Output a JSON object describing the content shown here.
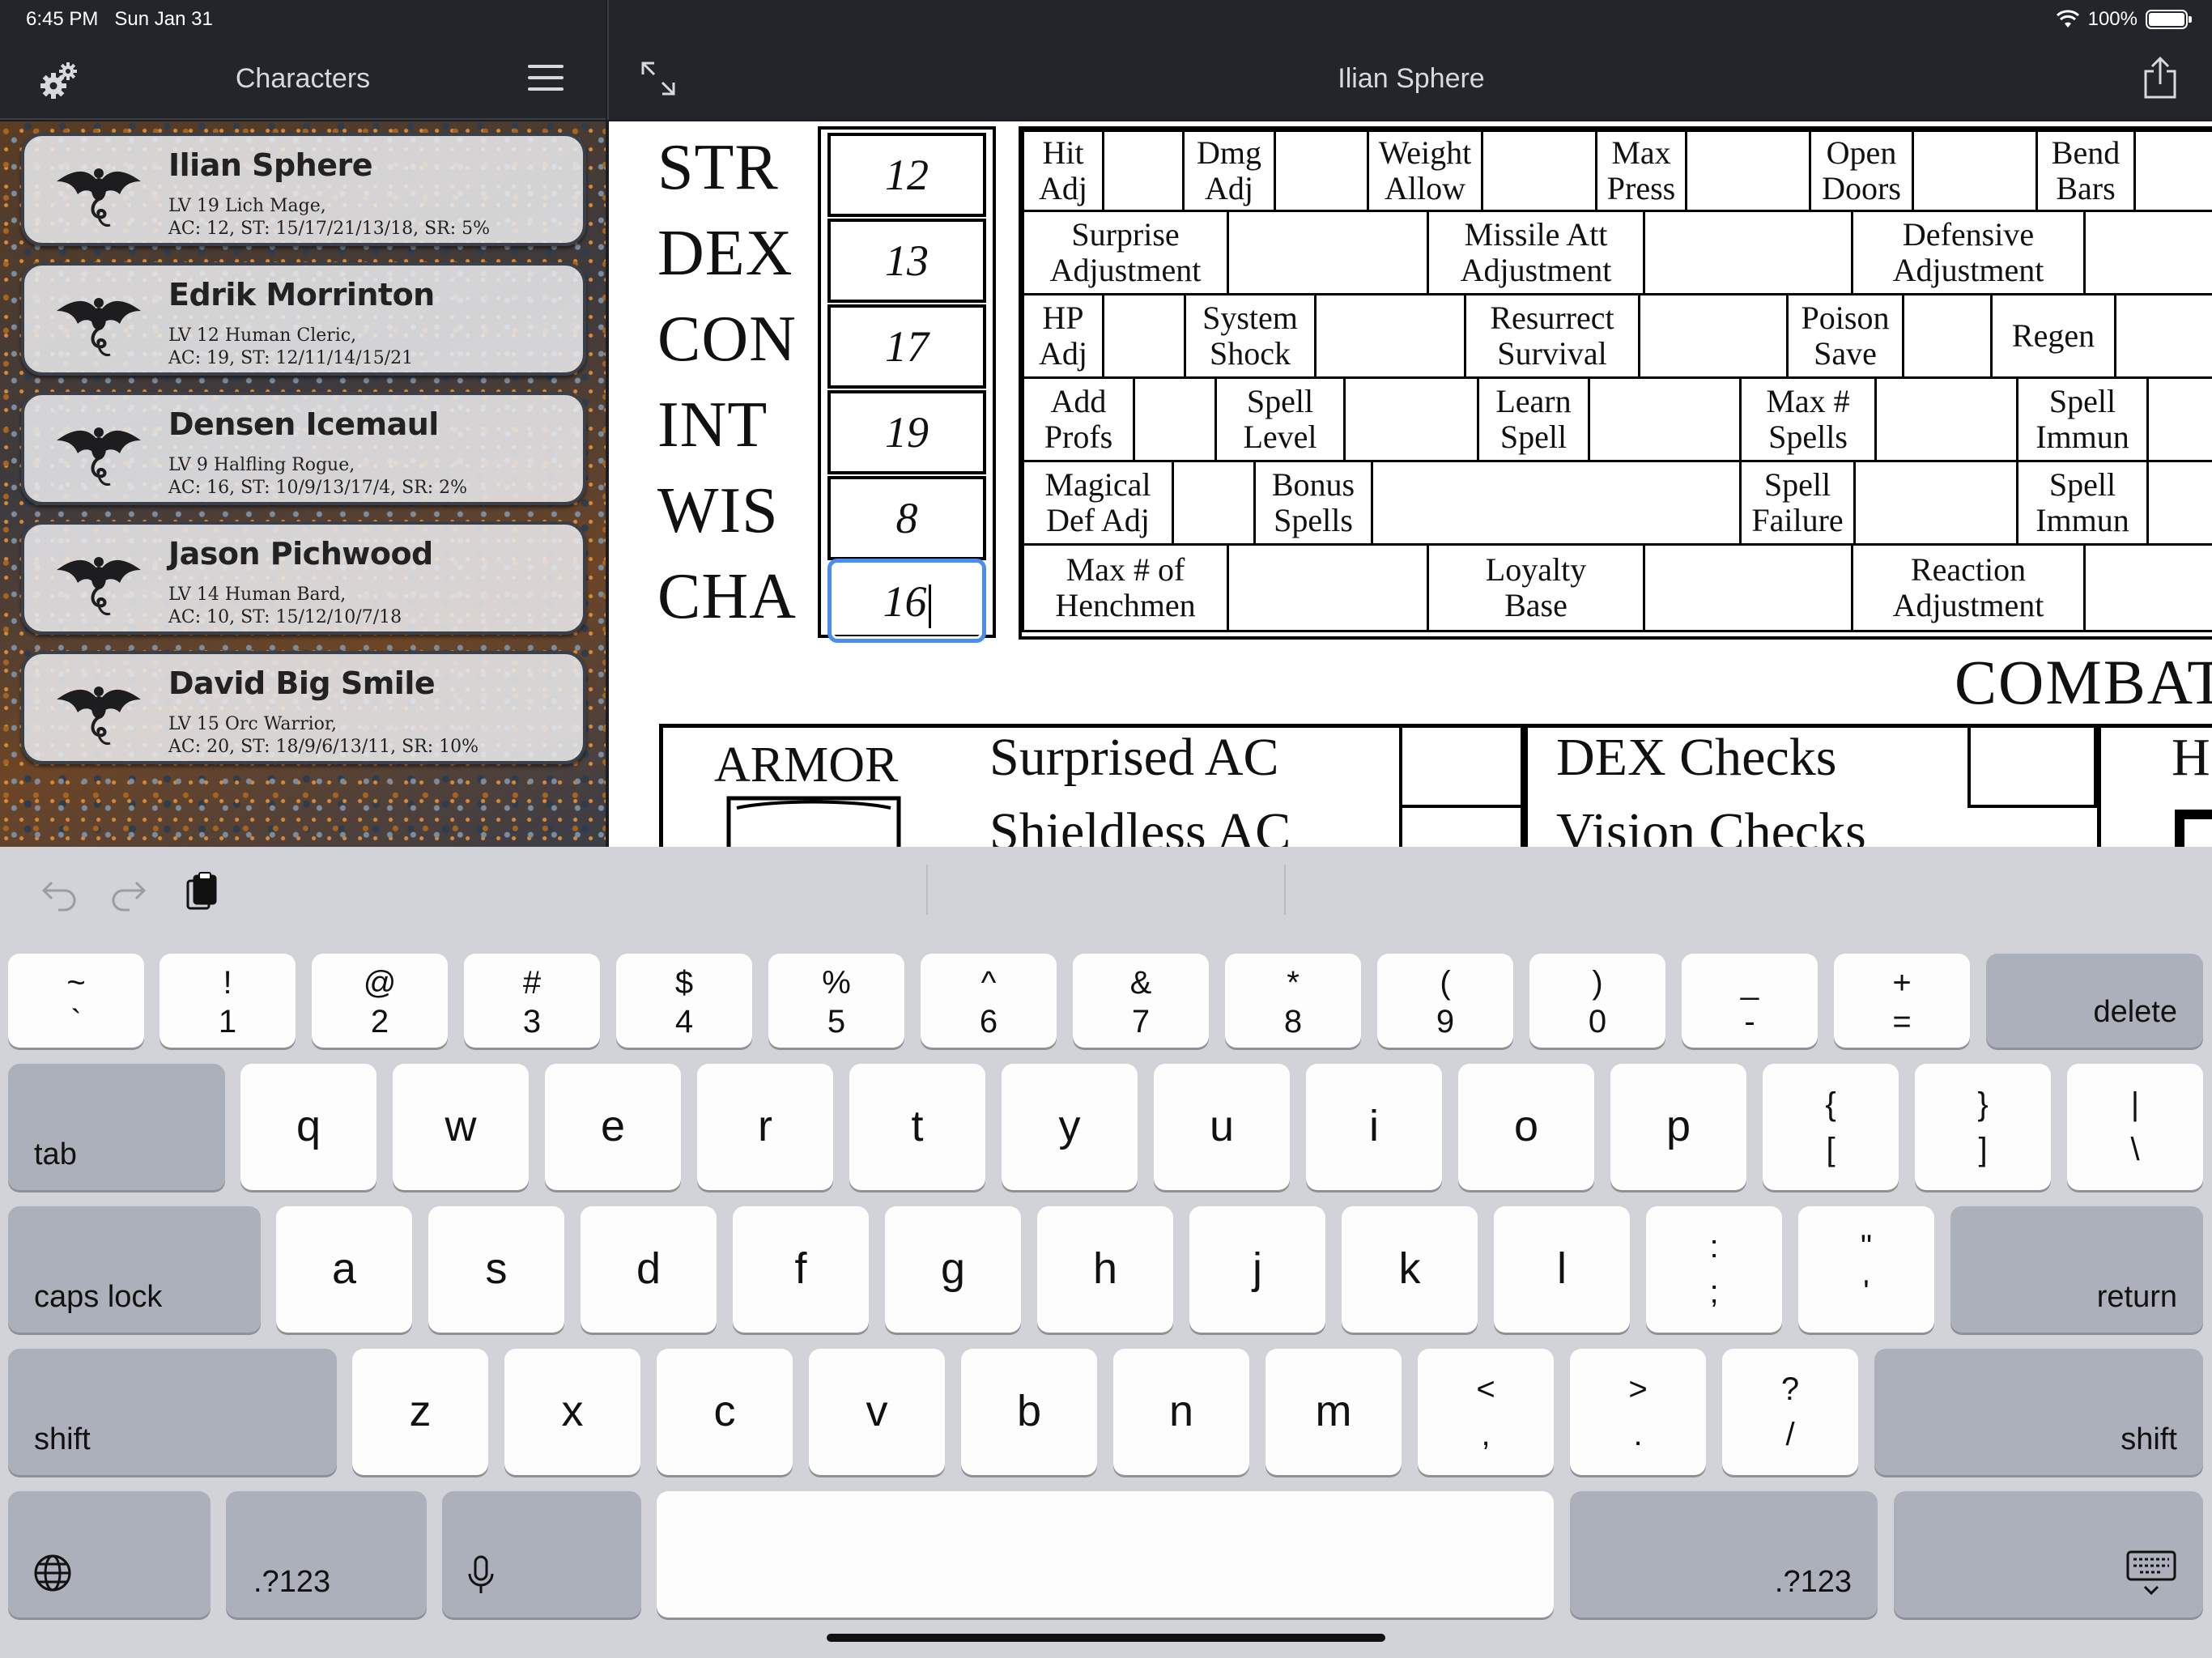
{
  "status_bar": {
    "time": "6:45 PM",
    "date": "Sun Jan 31",
    "battery": "100%",
    "battery_level": 1.0
  },
  "sidebar": {
    "title": "Characters",
    "characters": [
      {
        "name": "Ilian Sphere",
        "line1": "LV 19  Lich  Mage,",
        "line2": "AC: 12, ST: 15/17/21/13/18, SR: 5%"
      },
      {
        "name": "Edrik Morrinton",
        "line1": "LV 12  Human  Cleric,",
        "line2": "AC: 19, ST: 12/11/14/15/21"
      },
      {
        "name": "Densen Icemaul",
        "line1": "LV 9  Halfling  Rogue,",
        "line2": "AC: 16, ST: 10/9/13/17/4, SR: 2%"
      },
      {
        "name": "Jason Pichwood",
        "line1": "LV 14  Human  Bard,",
        "line2": "AC: 10, ST: 15/12/10/7/18"
      },
      {
        "name": "David Big Smile",
        "line1": "LV 15  Orc  Warrior,",
        "line2": "AC: 20, ST: 18/9/6/13/11, SR: 10%"
      }
    ]
  },
  "detail": {
    "title": "Ilian Sphere",
    "abilities": [
      {
        "label": "STR",
        "value": "12"
      },
      {
        "label": "DEX",
        "value": "13"
      },
      {
        "label": "CON",
        "value": "17"
      },
      {
        "label": "INT",
        "value": "19"
      },
      {
        "label": "WIS",
        "value": "8"
      },
      {
        "label": "CHA",
        "value": "16"
      }
    ],
    "str_row": [
      "Hit\nAdj",
      "Dmg\nAdj",
      "Weight\nAllow",
      "Max\nPress",
      "Open\nDoors",
      "Bend\nBars"
    ],
    "dex_row": [
      "Surprise\nAdjustment",
      "Missile Att\nAdjustment",
      "Defensive\nAdjustment"
    ],
    "con_row": [
      "HP\nAdj",
      "System\nShock",
      "Resurrect\nSurvival",
      "Poison\nSave",
      "Regen"
    ],
    "int_row": [
      "Add\nProfs",
      "Spell\nLevel",
      "Learn\nSpell",
      "Max #\nSpells",
      "Spell\nImmun"
    ],
    "wis_row": [
      "Magical\nDef Adj",
      "Bonus\nSpells",
      "Spell\nFailure",
      "Spell\nImmun"
    ],
    "cha_row": [
      "Max # of\nHenchmen",
      "Loyalty\nBase",
      "Reaction\nAdjustment"
    ],
    "combat_title": "COMBAT",
    "armor_label": "ARMOR",
    "surprised_ac": "Surprised AC",
    "shieldless_ac": "Shieldless AC",
    "dex_checks": "DEX Checks",
    "vision_checks": "Vision Checks",
    "h_label": "H"
  },
  "keyboard": {
    "row1": [
      {
        "top": "~",
        "bot": "`"
      },
      {
        "top": "!",
        "bot": "1"
      },
      {
        "top": "@",
        "bot": "2"
      },
      {
        "top": "#",
        "bot": "3"
      },
      {
        "top": "$",
        "bot": "4"
      },
      {
        "top": "%",
        "bot": "5"
      },
      {
        "top": "^",
        "bot": "6"
      },
      {
        "top": "&",
        "bot": "7"
      },
      {
        "top": "*",
        "bot": "8"
      },
      {
        "top": "(",
        "bot": "9"
      },
      {
        "top": ")",
        "bot": "0"
      },
      {
        "top": "_",
        "bot": "-"
      },
      {
        "top": "+",
        "bot": "="
      }
    ],
    "delete": "delete",
    "tab": "tab",
    "row2": [
      "q",
      "w",
      "e",
      "r",
      "t",
      "y",
      "u",
      "i",
      "o",
      "p"
    ],
    "row2_sym": [
      {
        "top": "{",
        "bot": "["
      },
      {
        "top": "}",
        "bot": "]"
      },
      {
        "top": "|",
        "bot": "\\"
      }
    ],
    "caps_lock": "caps lock",
    "row3": [
      "a",
      "s",
      "d",
      "f",
      "g",
      "h",
      "j",
      "k",
      "l"
    ],
    "row3_sym": [
      {
        "top": ":",
        "bot": ";"
      },
      {
        "top": "\"",
        "bot": "'"
      }
    ],
    "return": "return",
    "shift": "shift",
    "row4": [
      "z",
      "x",
      "c",
      "v",
      "b",
      "n",
      "m"
    ],
    "row4_sym": [
      {
        "top": "<",
        "bot": ","
      },
      {
        "top": ">",
        "bot": "."
      },
      {
        "top": "?",
        "bot": "/"
      }
    ],
    "numbers_key": ".?123"
  }
}
